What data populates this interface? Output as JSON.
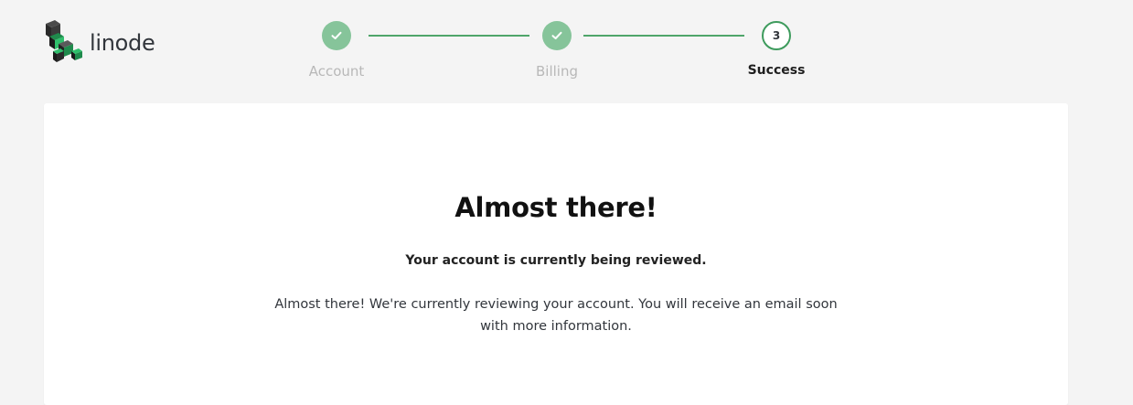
{
  "brand": {
    "name": "linode",
    "accent_color": "#3e9b5d",
    "done_color": "#86c49a"
  },
  "stepper": {
    "steps": [
      {
        "label": "Account",
        "state": "done",
        "icon": "check-icon"
      },
      {
        "label": "Billing",
        "state": "done",
        "icon": "check-icon"
      },
      {
        "label": "Success",
        "state": "current",
        "number": "3"
      }
    ]
  },
  "card": {
    "title": "Almost there!",
    "subtitle": "Your account is currently being reviewed.",
    "body": "Almost there! We're currently reviewing your account. You will receive an email soon with more information."
  }
}
